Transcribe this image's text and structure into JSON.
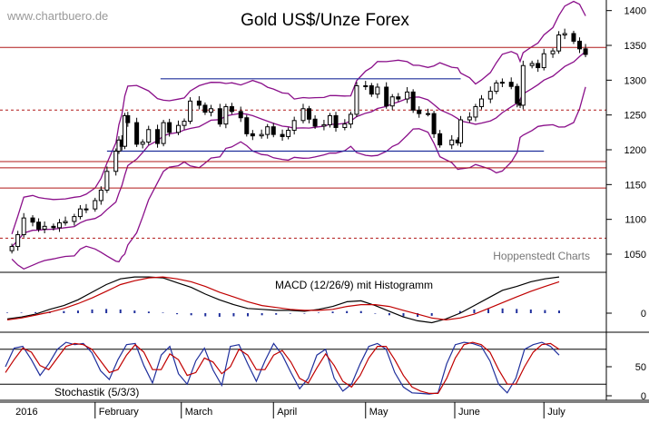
{
  "watermark": "www.chartbuero.de",
  "credit": "Hoppenstedt Charts",
  "colors": {
    "background": "#ffffff",
    "candle": "#000000",
    "bollinger": "#8a0f8a",
    "resistance": "#b01818",
    "channel": "#1f2f9c",
    "macd_line": "#000000",
    "signal_line": "#c00000",
    "histogram": "#1f2f9c",
    "stoch_k": "#1f2f9c",
    "stoch_d": "#c00000",
    "grid": "#777777"
  },
  "chart_data": [
    {
      "type": "candlestick",
      "title": "Gold US$/Unze Forex",
      "y_ticks": [
        "1400",
        "1350",
        "1300",
        "1250",
        "1200",
        "1150",
        "1100",
        "1050"
      ],
      "ylim": [
        1040,
        1410
      ],
      "x_labels": [
        "2016",
        "February",
        "March",
        "April",
        "May",
        "June",
        "July"
      ],
      "x_label_dates": [
        "2016-01-04",
        "2016-02-01",
        "2016-03-01",
        "2016-04-01",
        "2016-05-02",
        "2016-06-01",
        "2016-07-01"
      ],
      "date_range": [
        "2015-12-31",
        "2016-07-22"
      ],
      "overlays": [
        "Bollinger upper",
        "Bollinger middle",
        "Bollinger lower"
      ],
      "horizontal_lines": {
        "solid_red": [
          1347,
          1183,
          1174,
          1145
        ],
        "dashed_red": [
          1257,
          1073
        ],
        "blue_channel": [
          {
            "from": "2016-02-23",
            "to": "2016-06-03",
            "value": 1302
          },
          {
            "from": "2016-02-05",
            "to": "2016-07-01",
            "value": 1198
          }
        ]
      },
      "series": [
        {
          "points": [
            [
              "2016-01-04",
              1061
            ],
            [
              "2016-01-06",
              1078
            ],
            [
              "2016-01-08",
              1102
            ],
            [
              "2016-01-11",
              1096
            ],
            [
              "2016-01-13",
              1086
            ],
            [
              "2016-01-15",
              1090
            ],
            [
              "2016-01-18",
              1088
            ],
            [
              "2016-01-20",
              1095
            ],
            [
              "2016-01-22",
              1097
            ],
            [
              "2016-01-25",
              1104
            ],
            [
              "2016-01-27",
              1115
            ],
            [
              "2016-01-29",
              1115
            ],
            [
              "2016-02-01",
              1127
            ],
            [
              "2016-02-03",
              1142
            ],
            [
              "2016-02-05",
              1169
            ],
            [
              "2016-02-08",
              1198
            ],
            [
              "2016-02-09",
              1214
            ],
            [
              "2016-02-10",
              1205
            ],
            [
              "2016-02-11",
              1249
            ],
            [
              "2016-02-12",
              1239
            ],
            [
              "2016-02-15",
              1208
            ],
            [
              "2016-02-17",
              1211
            ],
            [
              "2016-02-19",
              1229
            ],
            [
              "2016-02-22",
              1209
            ],
            [
              "2016-02-24",
              1239
            ],
            [
              "2016-02-26",
              1225
            ],
            [
              "2016-02-29",
              1235
            ],
            [
              "2016-03-02",
              1241
            ],
            [
              "2016-03-04",
              1270
            ],
            [
              "2016-03-07",
              1264
            ],
            [
              "2016-03-09",
              1254
            ],
            [
              "2016-03-11",
              1259
            ],
            [
              "2016-03-14",
              1237
            ],
            [
              "2016-03-16",
              1262
            ],
            [
              "2016-03-18",
              1255
            ],
            [
              "2016-03-21",
              1246
            ],
            [
              "2016-03-23",
              1223
            ],
            [
              "2016-03-25",
              1220
            ],
            [
              "2016-03-28",
              1222
            ],
            [
              "2016-03-30",
              1233
            ],
            [
              "2016-04-01",
              1222
            ],
            [
              "2016-04-04",
              1219
            ],
            [
              "2016-04-06",
              1228
            ],
            [
              "2016-04-08",
              1242
            ],
            [
              "2016-04-11",
              1259
            ],
            [
              "2016-04-13",
              1244
            ],
            [
              "2016-04-15",
              1234
            ],
            [
              "2016-04-18",
              1236
            ],
            [
              "2016-04-20",
              1249
            ],
            [
              "2016-04-22",
              1232
            ],
            [
              "2016-04-25",
              1237
            ],
            [
              "2016-04-27",
              1251
            ],
            [
              "2016-04-29",
              1292
            ],
            [
              "2016-05-02",
              1292
            ],
            [
              "2016-05-04",
              1280
            ],
            [
              "2016-05-06",
              1290
            ],
            [
              "2016-05-09",
              1263
            ],
            [
              "2016-05-11",
              1276
            ],
            [
              "2016-05-13",
              1273
            ],
            [
              "2016-05-16",
              1283
            ],
            [
              "2016-05-18",
              1257
            ],
            [
              "2016-05-20",
              1252
            ],
            [
              "2016-05-23",
              1252
            ],
            [
              "2016-05-25",
              1223
            ],
            [
              "2016-05-27",
              1207
            ],
            [
              "2016-05-31",
              1214
            ],
            [
              "2016-06-02",
              1210
            ],
            [
              "2016-06-03",
              1243
            ],
            [
              "2016-06-06",
              1247
            ],
            [
              "2016-06-08",
              1262
            ],
            [
              "2016-06-10",
              1273
            ],
            [
              "2016-06-13",
              1284
            ],
            [
              "2016-06-15",
              1296
            ],
            [
              "2016-06-17",
              1297
            ],
            [
              "2016-06-20",
              1291
            ],
            [
              "2016-06-22",
              1267
            ],
            [
              "2016-06-23",
              1264
            ],
            [
              "2016-06-24",
              1321
            ],
            [
              "2016-06-27",
              1324
            ],
            [
              "2016-06-29",
              1318
            ],
            [
              "2016-07-01",
              1338
            ],
            [
              "2016-07-04",
              1342
            ],
            [
              "2016-07-06",
              1365
            ],
            [
              "2016-07-08",
              1367
            ],
            [
              "2016-07-11",
              1356
            ],
            [
              "2016-07-13",
              1345
            ],
            [
              "2016-07-15",
              1337
            ]
          ]
        }
      ]
    },
    {
      "type": "line",
      "title": "MACD (12/26/9) mit Histogramm",
      "y_ticks": [
        "0"
      ],
      "series": [
        {
          "values": [
            -6,
            -4,
            -1,
            4,
            8,
            14,
            22,
            30,
            36,
            38,
            38,
            37,
            32,
            27,
            20,
            14,
            9,
            5,
            4,
            3,
            3,
            2,
            4,
            7,
            12,
            13,
            8,
            2,
            -4,
            -8,
            -10,
            -6,
            0,
            8,
            16,
            24,
            28,
            33,
            36,
            38
          ]
        },
        {
          "values": [
            -7,
            -5,
            -2,
            1,
            5,
            10,
            16,
            23,
            30,
            34,
            37,
            38,
            36,
            33,
            28,
            22,
            17,
            12,
            8,
            6,
            4,
            3,
            3,
            4,
            7,
            9,
            9,
            7,
            3,
            -1,
            -5,
            -7,
            -5,
            -1,
            5,
            11,
            17,
            23,
            28,
            33
          ]
        }
      ],
      "histogram": [
        1,
        1,
        2,
        3,
        4,
        5,
        7,
        8,
        7,
        5,
        3,
        1,
        -2,
        -4,
        -6,
        -7,
        -6,
        -6,
        -4,
        -3,
        -1,
        -1,
        1,
        3,
        4,
        4,
        -1,
        -4,
        -6,
        -7,
        -5,
        0,
        4,
        7,
        8,
        9,
        8,
        7,
        6,
        5
      ]
    },
    {
      "type": "line",
      "title": "Stochastik (5/3/3)",
      "y_ticks": [
        "50",
        "0"
      ],
      "ylim": [
        0,
        100
      ],
      "reference_lines": [
        20,
        80
      ],
      "series": [
        {
          "values": [
            50,
            82,
            85,
            62,
            35,
            55,
            80,
            92,
            88,
            90,
            74,
            43,
            28,
            62,
            88,
            90,
            52,
            22,
            70,
            85,
            38,
            20,
            60,
            82,
            44,
            18,
            85,
            88,
            55,
            25,
            60,
            90,
            70,
            40,
            12,
            30,
            70,
            80,
            30,
            8,
            20,
            55,
            85,
            90,
            80,
            40,
            15,
            5,
            4,
            3,
            5,
            55,
            88,
            92,
            90,
            85,
            60,
            20,
            5,
            30,
            80,
            88,
            92,
            85,
            70
          ]
        },
        {
          "values": [
            40,
            62,
            82,
            75,
            52,
            45,
            65,
            85,
            90,
            88,
            80,
            60,
            40,
            45,
            70,
            88,
            75,
            45,
            45,
            72,
            62,
            35,
            40,
            65,
            58,
            38,
            50,
            80,
            70,
            45,
            45,
            70,
            78,
            58,
            30,
            22,
            48,
            72,
            52,
            25,
            15,
            35,
            65,
            85,
            85,
            62,
            35,
            15,
            8,
            4,
            4,
            30,
            65,
            88,
            92,
            88,
            75,
            45,
            20,
            20,
            50,
            75,
            88,
            90,
            80
          ]
        }
      ]
    }
  ]
}
